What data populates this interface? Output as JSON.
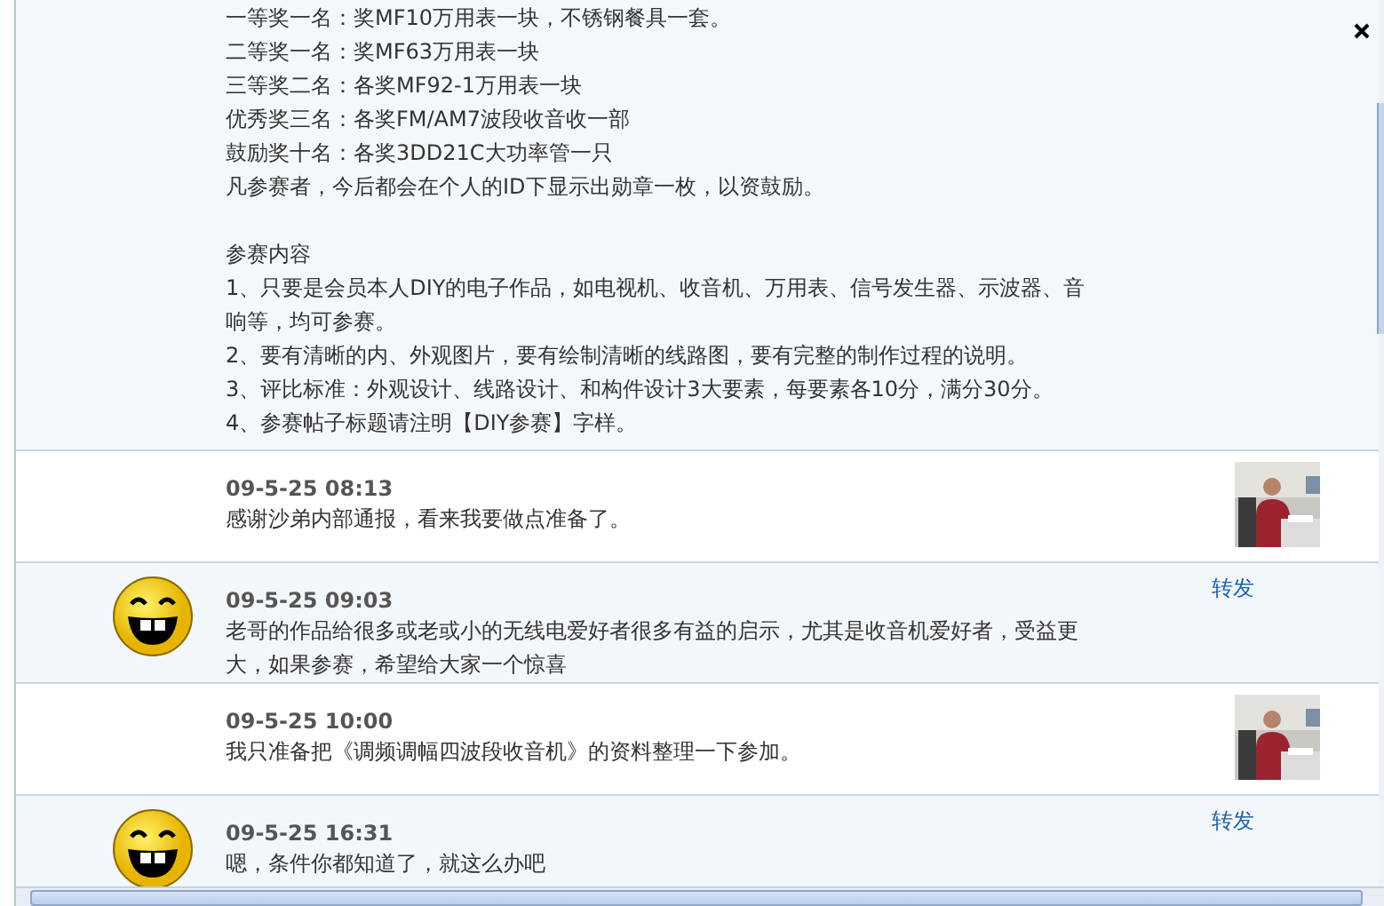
{
  "post": {
    "sections": [
      {
        "lines": [
          "一等奖一名：奖MF10万用表一块，不锈钢餐具一套。",
          "二等奖一名：奖MF63万用表一块",
          "三等奖二名：各奖MF92-1万用表一块",
          "优秀奖三名：各奖FM/AM7波段收音收一部",
          "鼓励奖十名：各奖3DD21C大功率管一只",
          "凡参赛者，今后都会在个人的ID下显示出勋章一枚，以资鼓励。"
        ]
      },
      {
        "lines": [
          "参赛内容",
          "1、只要是会员本人DIY的电子作品，如电视机、收音机、万用表、信号发生器、示波器、音响等，均可参赛。",
          "2、要有清晰的内、外观图片，要有绘制清晰的线路图，要有完整的制作过程的说明。",
          "3、评比标准：外观设计、线路设计、和构件设计3大要素，每要素各10分，满分30分。",
          "4、参赛帖子标题请注明【DIY参赛】字样。"
        ]
      }
    ]
  },
  "comments": [
    {
      "time": "09-5-25 08:13",
      "text": "感谢沙弟内部通报，看来我要做点准备了。"
    },
    {
      "kind": "smiley",
      "time": "09-5-25 09:03",
      "text": "老哥的作品给很多或老或小的无线电爱好者很多有益的启示，尤其是收音机爱好者，受益更大，如果参赛，希望给大家一个惊喜",
      "action": "转发"
    },
    {
      "time": "09-5-25 10:00",
      "text": "我只准备把《调频调幅四波段收音机》的资料整理一下参加。"
    },
    {
      "kind": "smiley",
      "time": "09-5-25 16:31",
      "text": "嗯，条件你都知道了，就这么办吧",
      "action": "转发"
    }
  ]
}
